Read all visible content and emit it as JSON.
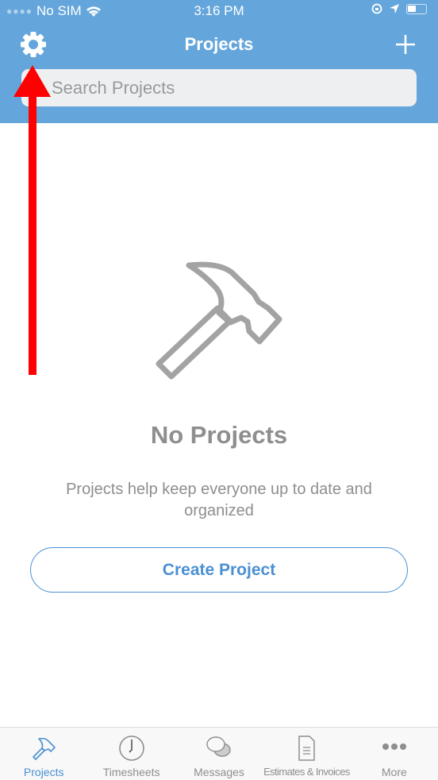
{
  "status_bar": {
    "carrier": "No SIM",
    "time": "3:16 PM"
  },
  "header": {
    "title": "Projects",
    "search_placeholder": "Search Projects"
  },
  "empty_state": {
    "icon": "hammer-icon",
    "title": "No Projects",
    "description": "Projects help keep everyone up to date and organized",
    "button": "Create Project"
  },
  "tabs": [
    {
      "label": "Projects",
      "icon": "hammer-icon",
      "active": true
    },
    {
      "label": "Timesheets",
      "icon": "clock-icon"
    },
    {
      "label": "Messages",
      "icon": "chat-bubbles-icon"
    },
    {
      "label": "Estimates & Invoices",
      "icon": "document-icon"
    },
    {
      "label": "More",
      "icon": "more-dots-icon"
    }
  ],
  "colors": {
    "header": "#64a6db",
    "accent": "#4a90d2",
    "annotation_arrow": "#ff0000"
  }
}
